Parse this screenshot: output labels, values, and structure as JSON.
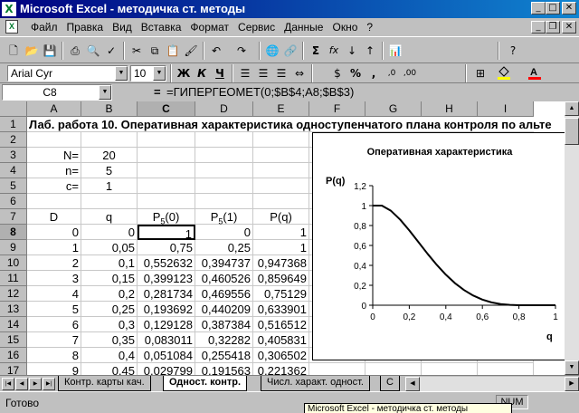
{
  "window": {
    "title": "Microsoft Excel - методичка ст. методы",
    "app_icon": "excel-logo"
  },
  "menu": [
    "Файл",
    "Правка",
    "Вид",
    "Вставка",
    "Формат",
    "Сервис",
    "Данные",
    "Окно",
    "?"
  ],
  "toolbar_standard": {
    "icons": [
      "new-icon",
      "open-icon",
      "save-icon",
      "print-icon",
      "print-preview-icon",
      "spelling-icon",
      "cut-icon",
      "copy-icon",
      "paste-icon",
      "format-painter-icon",
      "undo-icon",
      "redo-icon",
      "hyperlink-icon",
      "web-toolbar-icon",
      "autosum-icon",
      "function-icon",
      "sort-ascending-icon",
      "sort-descending-icon",
      "chart-wizard-icon",
      "help-icon"
    ],
    "autosum_glyph": "Σ",
    "function_glyph": "fx"
  },
  "toolbar_formatting": {
    "font": "Arial Cyr",
    "size": "10",
    "bold": "Ж",
    "italic": "К",
    "underline": "Ч",
    "percent": "%",
    "comma": ",",
    "icons": [
      "align-left-icon",
      "align-center-icon",
      "align-right-icon",
      "merge-center-icon",
      "currency-icon",
      "increase-decimal-icon",
      "decrease-decimal-icon",
      "borders-icon",
      "fill-color-icon",
      "font-color-icon"
    ],
    "fill_color": "#ffff00",
    "font_color": "#ff0000"
  },
  "formula_bar": {
    "name_box": "C8",
    "eq": "=",
    "formula": "=ГИПЕРГЕОМЕТ(0;$B$4;A8;$B$3)"
  },
  "columns": [
    "A",
    "B",
    "C",
    "D",
    "E",
    "F",
    "G",
    "H",
    "I"
  ],
  "selected_column": "C",
  "rows": [
    "1",
    "2",
    "3",
    "4",
    "5",
    "6",
    "7",
    "8",
    "9",
    "10",
    "11",
    "12",
    "13",
    "14",
    "15",
    "16",
    "17"
  ],
  "selected_row": "8",
  "sheet": {
    "title": "Лаб. работа 10. Оперативная характеристика одноступенчатого плана контроля по альте",
    "params": [
      {
        "label": "N=",
        "value": "20"
      },
      {
        "label": "n=",
        "value": "5"
      },
      {
        "label": "c=",
        "value": "1"
      }
    ],
    "headers": [
      "D",
      "q",
      "P5(0)",
      "P5(1)",
      "P(q)"
    ],
    "data_rows": [
      [
        "0",
        "0",
        "1",
        "0",
        "1"
      ],
      [
        "1",
        "0,05",
        "0,75",
        "0,25",
        "1"
      ],
      [
        "2",
        "0,1",
        "0,552632",
        "0,394737",
        "0,947368"
      ],
      [
        "3",
        "0,15",
        "0,399123",
        "0,460526",
        "0,859649"
      ],
      [
        "4",
        "0,2",
        "0,281734",
        "0,469556",
        "0,75129"
      ],
      [
        "5",
        "0,25",
        "0,193692",
        "0,440209",
        "0,633901"
      ],
      [
        "6",
        "0,3",
        "0,129128",
        "0,387384",
        "0,516512"
      ],
      [
        "7",
        "0,35",
        "0,083011",
        "0,32282",
        "0,405831"
      ],
      [
        "8",
        "0,4",
        "0,051084",
        "0,255418",
        "0,306502"
      ],
      [
        "9",
        "0,45",
        "0,029799",
        "0,191563",
        "0,221362"
      ]
    ]
  },
  "chart_data": {
    "type": "line",
    "title": "Оперативная характеристика",
    "xlabel": "q",
    "ylabel": "P(q)",
    "xlim": [
      0,
      1
    ],
    "ylim": [
      0,
      1.2
    ],
    "xticks": [
      "0",
      "0,2",
      "0,4",
      "0,6",
      "0,8",
      "1"
    ],
    "yticks": [
      "0",
      "0,2",
      "0,4",
      "0,6",
      "0,8",
      "1",
      "1,2"
    ],
    "x": [
      0,
      0.05,
      0.1,
      0.15,
      0.2,
      0.25,
      0.3,
      0.35,
      0.4,
      0.45,
      0.5,
      0.55,
      0.6,
      0.65,
      0.7,
      0.75,
      0.8,
      0.85,
      0.9,
      0.95,
      1
    ],
    "series": [
      {
        "values": [
          1,
          1,
          0.947368,
          0.859649,
          0.75129,
          0.633901,
          0.516512,
          0.405831,
          0.306502,
          0.221362,
          0.151703,
          0.097007,
          0.056347,
          0.028386,
          0.011094,
          0.003096,
          0.000516,
          0,
          0,
          0,
          0
        ]
      }
    ],
    "line_color": "#000000",
    "grid": false
  },
  "tabs": [
    "Контр. карты кач.",
    "Одност. контр.",
    "Числ. характ. одност.",
    "С"
  ],
  "active_tab": "Одност. контр.",
  "status": {
    "ready": "Готово",
    "num": "NUM",
    "taskbar_tooltip": "Microsoft Excel - методичка ст. методы"
  }
}
